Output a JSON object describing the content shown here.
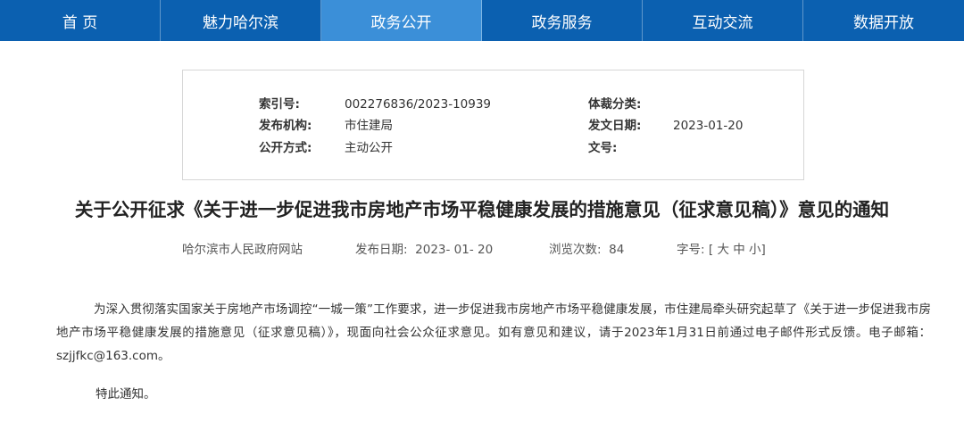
{
  "nav": [
    {
      "label": "首 页"
    },
    {
      "label": "魅力哈尔滨"
    },
    {
      "label": "政务公开"
    },
    {
      "label": "政务服务"
    },
    {
      "label": "互动交流"
    },
    {
      "label": "数据开放"
    }
  ],
  "meta": {
    "index_label": "索引号:",
    "index_value": "002276836/2023-10939",
    "genre_label": "体裁分类:",
    "genre_value": "",
    "publisher_label": "发布机构:",
    "publisher_value": "市住建局",
    "issue_date_label": "发文日期:",
    "issue_date_value": "2023-01-20",
    "open_label": "公开方式:",
    "open_value": "主动公开",
    "doc_no_label": "文号:",
    "doc_no_value": ""
  },
  "article": {
    "title": "关于公开征求《关于进一步促进我市房地产市场平稳健康发展的措施意见（征求意见稿）》意见的通知",
    "site": "哈尔滨市人民政府网站",
    "publish_label": "发布日期:",
    "publish_value": "2023- 01- 20",
    "views_label": "浏览次数:",
    "views_value": "84",
    "font_label": "字号:",
    "font_open": "[",
    "font_large": "大",
    "font_medium": "中",
    "font_small": "小",
    "font_close": "]",
    "paragraph1": "为深入贯彻落实国家关于房地产市场调控“一城一策”工作要求，进一步促进我市房地产市场平稳健康发展，市住建局牵头研究起草了《关于进一步促进我市房地产市场平稳健康发展的措施意见（征求意见稿）》，现面向社会公众征求意见。如有意见和建议，请于2023年1月31日前通过电子邮件形式反馈。电子邮箱：szjjfkc@163.com。",
    "paragraph2": "特此通知。"
  }
}
